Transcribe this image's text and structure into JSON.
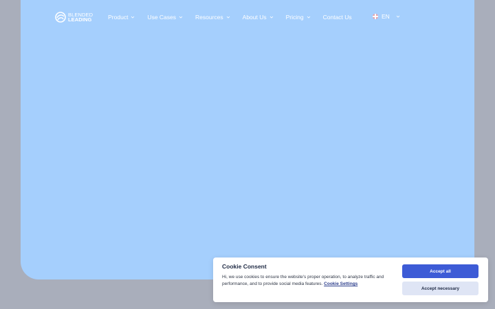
{
  "brand": {
    "logo_line1": "BLENDED",
    "logo_line2": "LEADING",
    "icon": "globe-swirl-icon"
  },
  "nav": {
    "items": [
      {
        "label": "Product",
        "has_dropdown": true
      },
      {
        "label": "Use Cases",
        "has_dropdown": true
      },
      {
        "label": "Resources",
        "has_dropdown": true
      },
      {
        "label": "About Us",
        "has_dropdown": true
      },
      {
        "label": "Pricing",
        "has_dropdown": true
      },
      {
        "label": "Contact Us",
        "has_dropdown": false
      }
    ],
    "language": {
      "label": "EN",
      "icon": "uk-flag-icon"
    }
  },
  "cookie": {
    "title": "Cookie Consent",
    "text": "Hi, we use cookies to ensure the website's proper operation, to analyze traffic and performance, and to provide social media features.",
    "link_label": "Cookie Settings",
    "accept_all_label": "Accept all",
    "accept_necessary_label": "Accept necessary"
  },
  "colors": {
    "page_background": "#a9aebb",
    "hero_background": "#a5cffd",
    "primary_button": "#3d5bd6",
    "secondary_button": "#dfe5f5"
  }
}
